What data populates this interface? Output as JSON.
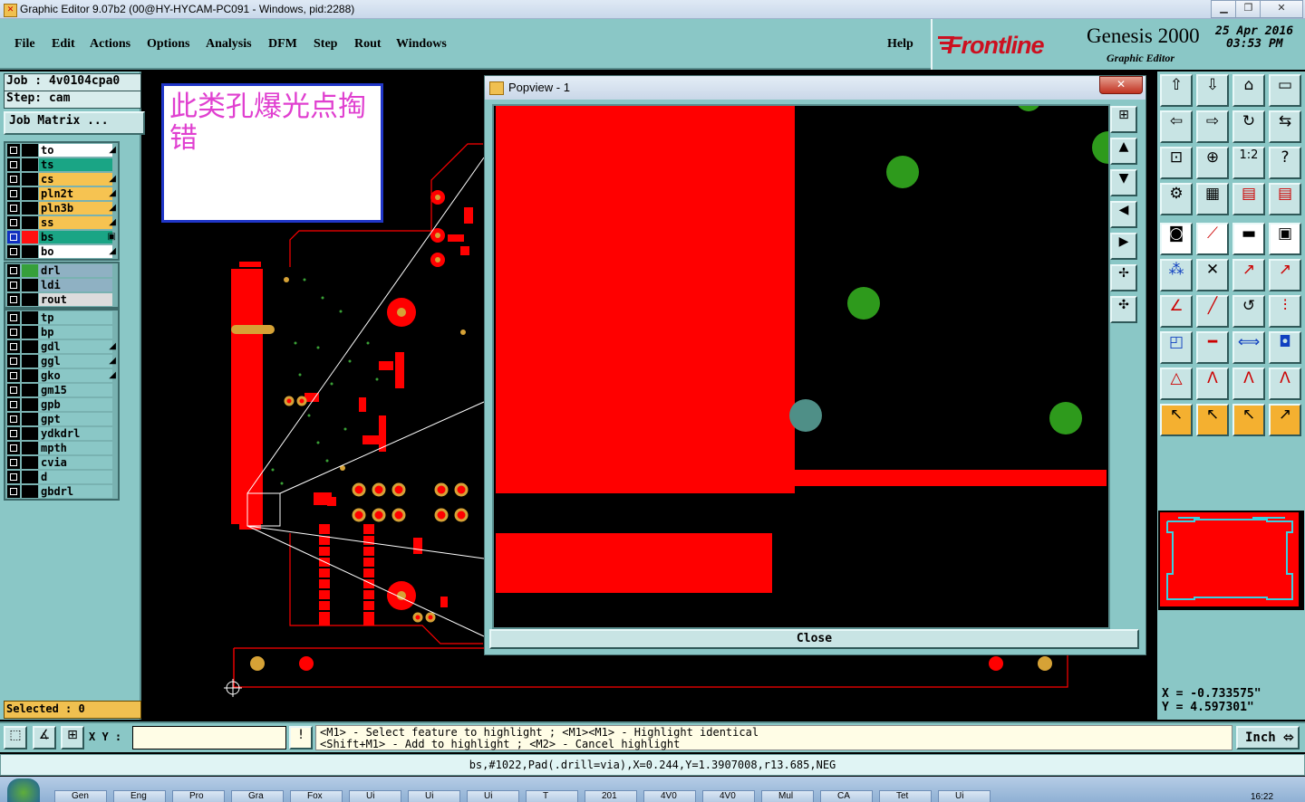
{
  "window": {
    "title": "Graphic Editor 9.07b2 (00@HY-HYCAM-PC091 - Windows, pid:2288)",
    "min": "▁",
    "max": "❐",
    "close": "✕"
  },
  "menu": {
    "file": "File",
    "edit": "Edit",
    "actions": "Actions",
    "options": "Options",
    "analysis": "Analysis",
    "dfm": "DFM",
    "step": "Step",
    "rout": "Rout",
    "windows": "Windows",
    "help": "Help"
  },
  "brand": {
    "logo": "Frontline",
    "product": "Genesis 2000",
    "subtitle": "Graphic Editor",
    "date": "25 Apr 2016",
    "time": "03:53 PM"
  },
  "job": {
    "job_line": "Job : 4v0104cpa0",
    "step_line": "Step: cam",
    "matrix_btn": "Job Matrix ..."
  },
  "layers": [
    {
      "name": "to",
      "swatch": "#000000",
      "bg": "#ffffff",
      "sym": "◢"
    },
    {
      "name": "ts",
      "swatch": "#000000",
      "bg": "#1aa585",
      "sym": ""
    },
    {
      "name": "cs",
      "swatch": "#000000",
      "bg": "#f6c351",
      "sym": "◢"
    },
    {
      "name": "pln2t",
      "swatch": "#000000",
      "bg": "#f6c351",
      "sym": "◢"
    },
    {
      "name": "pln3b",
      "swatch": "#000000",
      "bg": "#f6c351",
      "sym": "◢"
    },
    {
      "name": "ss",
      "swatch": "#000000",
      "bg": "#f6c351",
      "sym": "◢"
    },
    {
      "name": "bs",
      "swatch": "#ff1010",
      "bg": "#1aa585",
      "sym": "▣"
    },
    {
      "name": "bo",
      "swatch": "#000000",
      "bg": "#ffffff",
      "sym": "◢"
    }
  ],
  "layers2": [
    {
      "name": "drl",
      "swatch": "#36a03a",
      "bg": "#8fb1c3",
      "sym": ""
    },
    {
      "name": "ldi",
      "swatch": "#000000",
      "bg": "#8fb1c3",
      "sym": ""
    },
    {
      "name": "rout",
      "swatch": "#000000",
      "bg": "#dcdcdc",
      "sym": ""
    }
  ],
  "layers3": [
    {
      "name": "tp",
      "sym": ""
    },
    {
      "name": "bp",
      "sym": ""
    },
    {
      "name": "gdl",
      "sym": "◢"
    },
    {
      "name": "ggl",
      "sym": "◢"
    },
    {
      "name": "gko",
      "sym": "◢"
    },
    {
      "name": "gm15",
      "sym": ""
    },
    {
      "name": "gpb",
      "sym": ""
    },
    {
      "name": "gpt",
      "sym": ""
    },
    {
      "name": "ydkdrl",
      "sym": ""
    },
    {
      "name": "mpth",
      "sym": ""
    },
    {
      "name": "cvia",
      "sym": ""
    },
    {
      "name": "d",
      "sym": ""
    },
    {
      "name": "gbdrl",
      "sym": ""
    }
  ],
  "selected": "Selected : 0",
  "annotation": "此类孔爆光点掏错",
  "popview": {
    "title": "Popview - 1",
    "close_x": "✕",
    "close_button": "Close"
  },
  "coords": {
    "x": "X = -0.733575\"",
    "y": "Y = 4.597301\""
  },
  "bottom": {
    "xy_label": "X Y :",
    "hint_line1": "<M1> - Select feature to highlight ; <M1><M1> - Highlight identical",
    "hint_line2": "<Shift+M1> - Add to highlight ; <M2> - Cancel highlight",
    "unit": "Inch ⬄",
    "warn": "!"
  },
  "status": "bs,#1022,Pad(.drill=via),X=0.244,Y=1.3907008,r13.685,NEG",
  "taskbar": [
    "Gen",
    "Eng",
    "Pro",
    "Gra",
    "Fox",
    "Ui",
    "Ui",
    "Ui",
    "T",
    "201",
    "4V0",
    "4V0",
    "Mul",
    "CA",
    "Tet",
    "Ui"
  ],
  "clock": "16:22",
  "colors": {
    "panel": "#8ac7c6",
    "copper": "#ff0000",
    "drill": "#2e9a1c"
  }
}
